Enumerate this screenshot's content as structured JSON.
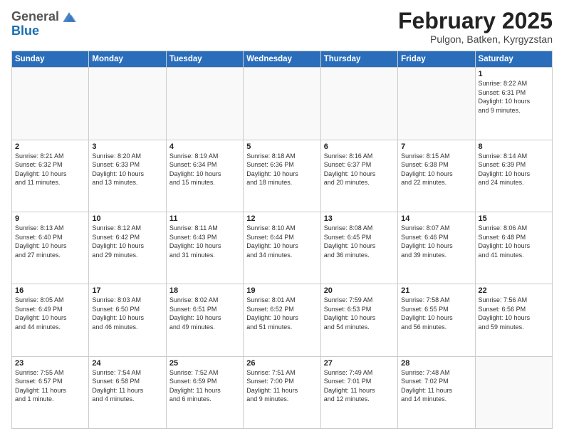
{
  "logo": {
    "general": "General",
    "blue": "Blue"
  },
  "header": {
    "month": "February 2025",
    "location": "Pulgon, Batken, Kyrgyzstan"
  },
  "weekdays": [
    "Sunday",
    "Monday",
    "Tuesday",
    "Wednesday",
    "Thursday",
    "Friday",
    "Saturday"
  ],
  "weeks": [
    [
      {
        "day": "",
        "info": ""
      },
      {
        "day": "",
        "info": ""
      },
      {
        "day": "",
        "info": ""
      },
      {
        "day": "",
        "info": ""
      },
      {
        "day": "",
        "info": ""
      },
      {
        "day": "",
        "info": ""
      },
      {
        "day": "1",
        "info": "Sunrise: 8:22 AM\nSunset: 6:31 PM\nDaylight: 10 hours\nand 9 minutes."
      }
    ],
    [
      {
        "day": "2",
        "info": "Sunrise: 8:21 AM\nSunset: 6:32 PM\nDaylight: 10 hours\nand 11 minutes."
      },
      {
        "day": "3",
        "info": "Sunrise: 8:20 AM\nSunset: 6:33 PM\nDaylight: 10 hours\nand 13 minutes."
      },
      {
        "day": "4",
        "info": "Sunrise: 8:19 AM\nSunset: 6:34 PM\nDaylight: 10 hours\nand 15 minutes."
      },
      {
        "day": "5",
        "info": "Sunrise: 8:18 AM\nSunset: 6:36 PM\nDaylight: 10 hours\nand 18 minutes."
      },
      {
        "day": "6",
        "info": "Sunrise: 8:16 AM\nSunset: 6:37 PM\nDaylight: 10 hours\nand 20 minutes."
      },
      {
        "day": "7",
        "info": "Sunrise: 8:15 AM\nSunset: 6:38 PM\nDaylight: 10 hours\nand 22 minutes."
      },
      {
        "day": "8",
        "info": "Sunrise: 8:14 AM\nSunset: 6:39 PM\nDaylight: 10 hours\nand 24 minutes."
      }
    ],
    [
      {
        "day": "9",
        "info": "Sunrise: 8:13 AM\nSunset: 6:40 PM\nDaylight: 10 hours\nand 27 minutes."
      },
      {
        "day": "10",
        "info": "Sunrise: 8:12 AM\nSunset: 6:42 PM\nDaylight: 10 hours\nand 29 minutes."
      },
      {
        "day": "11",
        "info": "Sunrise: 8:11 AM\nSunset: 6:43 PM\nDaylight: 10 hours\nand 31 minutes."
      },
      {
        "day": "12",
        "info": "Sunrise: 8:10 AM\nSunset: 6:44 PM\nDaylight: 10 hours\nand 34 minutes."
      },
      {
        "day": "13",
        "info": "Sunrise: 8:08 AM\nSunset: 6:45 PM\nDaylight: 10 hours\nand 36 minutes."
      },
      {
        "day": "14",
        "info": "Sunrise: 8:07 AM\nSunset: 6:46 PM\nDaylight: 10 hours\nand 39 minutes."
      },
      {
        "day": "15",
        "info": "Sunrise: 8:06 AM\nSunset: 6:48 PM\nDaylight: 10 hours\nand 41 minutes."
      }
    ],
    [
      {
        "day": "16",
        "info": "Sunrise: 8:05 AM\nSunset: 6:49 PM\nDaylight: 10 hours\nand 44 minutes."
      },
      {
        "day": "17",
        "info": "Sunrise: 8:03 AM\nSunset: 6:50 PM\nDaylight: 10 hours\nand 46 minutes."
      },
      {
        "day": "18",
        "info": "Sunrise: 8:02 AM\nSunset: 6:51 PM\nDaylight: 10 hours\nand 49 minutes."
      },
      {
        "day": "19",
        "info": "Sunrise: 8:01 AM\nSunset: 6:52 PM\nDaylight: 10 hours\nand 51 minutes."
      },
      {
        "day": "20",
        "info": "Sunrise: 7:59 AM\nSunset: 6:53 PM\nDaylight: 10 hours\nand 54 minutes."
      },
      {
        "day": "21",
        "info": "Sunrise: 7:58 AM\nSunset: 6:55 PM\nDaylight: 10 hours\nand 56 minutes."
      },
      {
        "day": "22",
        "info": "Sunrise: 7:56 AM\nSunset: 6:56 PM\nDaylight: 10 hours\nand 59 minutes."
      }
    ],
    [
      {
        "day": "23",
        "info": "Sunrise: 7:55 AM\nSunset: 6:57 PM\nDaylight: 11 hours\nand 1 minute."
      },
      {
        "day": "24",
        "info": "Sunrise: 7:54 AM\nSunset: 6:58 PM\nDaylight: 11 hours\nand 4 minutes."
      },
      {
        "day": "25",
        "info": "Sunrise: 7:52 AM\nSunset: 6:59 PM\nDaylight: 11 hours\nand 6 minutes."
      },
      {
        "day": "26",
        "info": "Sunrise: 7:51 AM\nSunset: 7:00 PM\nDaylight: 11 hours\nand 9 minutes."
      },
      {
        "day": "27",
        "info": "Sunrise: 7:49 AM\nSunset: 7:01 PM\nDaylight: 11 hours\nand 12 minutes."
      },
      {
        "day": "28",
        "info": "Sunrise: 7:48 AM\nSunset: 7:02 PM\nDaylight: 11 hours\nand 14 minutes."
      },
      {
        "day": "",
        "info": ""
      }
    ]
  ]
}
